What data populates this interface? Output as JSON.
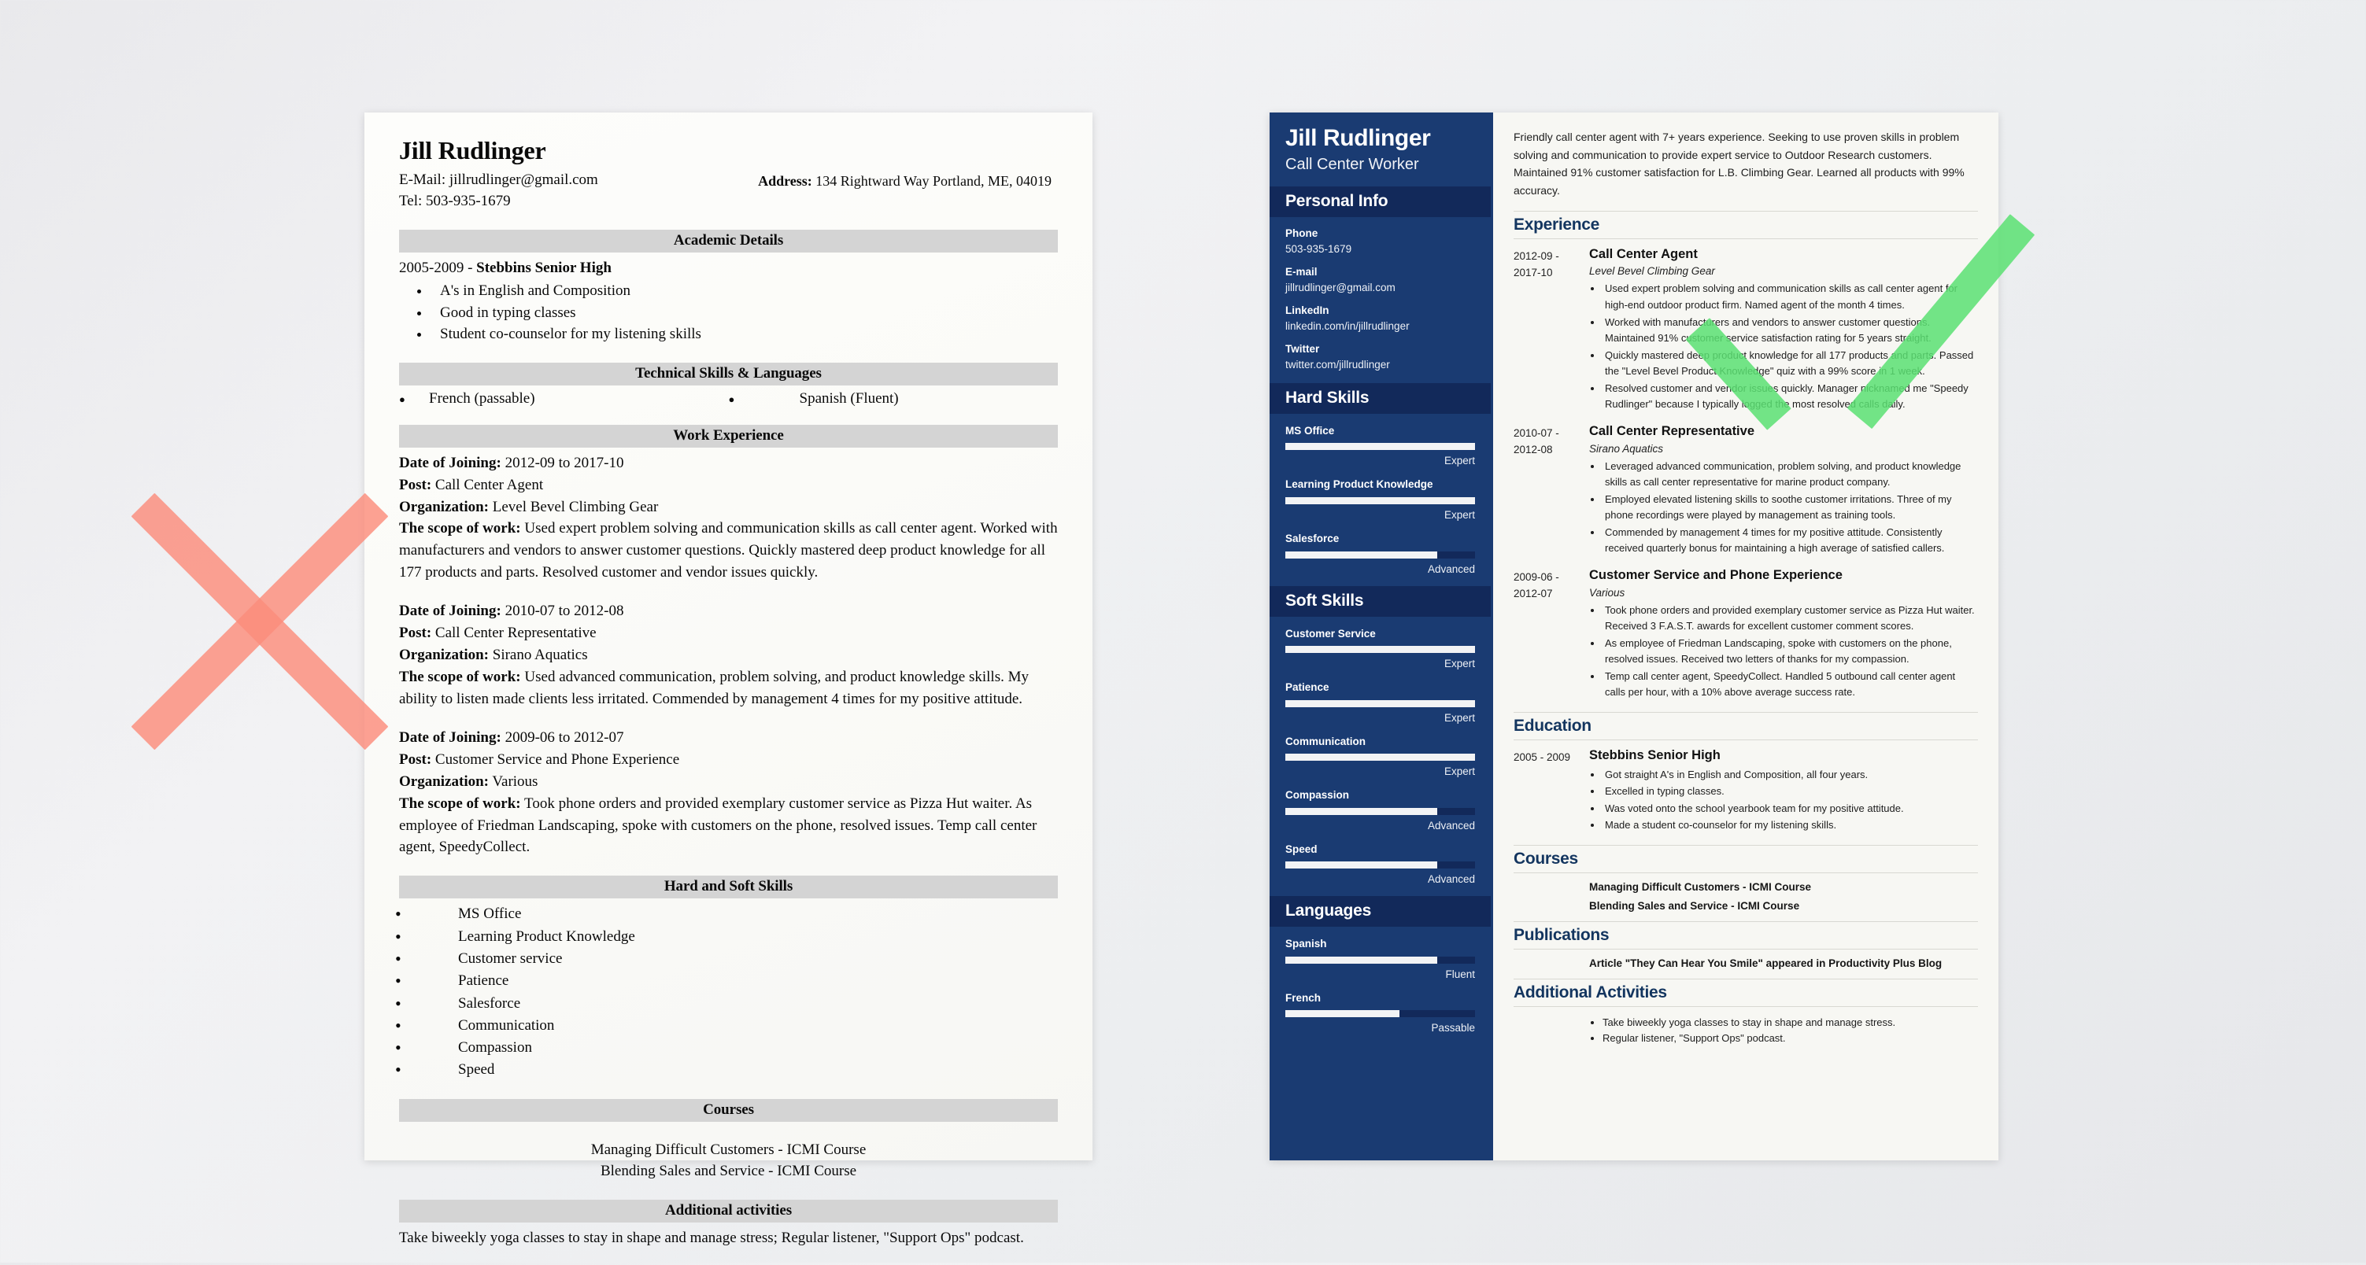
{
  "candidate": {
    "name": "Jill Rudlinger",
    "role": "Call Center Worker",
    "email": "jillrudlinger@gmail.com",
    "phone": "503-935-1679",
    "address": "134 Rightward Way Portland, ME, 04019",
    "linkedin": "linkedin.com/in/jillrudlinger",
    "twitter": "twitter.com/jillrudlinger"
  },
  "colors": {
    "sidebar_blue": "#1a3b72",
    "sidebar_header_blue": "#12295a",
    "accent_heading": "#13355f",
    "band_gray": "#d4d4d4",
    "mark_bad_red": "#FB8C7B",
    "mark_good_green": "#5BE072"
  },
  "marks": {
    "bad_mark": "x-mark",
    "good_mark": "check-mark"
  },
  "bad_resume": {
    "name": "Jill Rudlinger",
    "email_line": "E-Mail: jillrudlinger@gmail.com",
    "tel_line": "Tel: 503-935-1679",
    "address_label": "Address:",
    "address_value": "134 Rightward Way Portland, ME, 04019",
    "sections": {
      "academic": {
        "heading": "Academic Details",
        "school_line_years": "2005-2009 - ",
        "school_line_name": "Stebbins Senior High",
        "bullets": [
          "A's in English and Composition",
          "Good in typing classes",
          "Student co-counselor for my listening skills"
        ]
      },
      "technical": {
        "heading": "Technical Skills & Languages",
        "left": "French (passable)",
        "right": "Spanish (Fluent)"
      },
      "work": {
        "heading": "Work Experience",
        "jobs": [
          {
            "date_label": "Date of Joining:",
            "date_value": " 2012-09 to 2017-10",
            "post_label": "Post:",
            "post_value": " Call Center Agent",
            "org_label": "Organization:",
            "org_value": " Level Bevel Climbing Gear",
            "scope_label": "The scope of work:",
            "scope_value": " Used expert problem solving and communication skills as call center agent. Worked with manufacturers and vendors to answer customer questions. Quickly mastered deep product knowledge for all 177 products and parts. Resolved customer and vendor issues quickly."
          },
          {
            "date_label": "Date of Joining:",
            "date_value": " 2010-07 to 2012-08",
            "post_label": "Post:",
            "post_value": " Call Center Representative",
            "org_label": "Organization:",
            "org_value": " Sirano Aquatics",
            "scope_label": "The scope of work:",
            "scope_value": " Used advanced communication, problem solving, and product knowledge skills. My ability to listen made clients less irritated. Commended by management 4 times for my positive attitude."
          },
          {
            "date_label": "Date of Joining:",
            "date_value": " 2009-06 to 2012-07",
            "post_label": "Post:",
            "post_value": " Customer Service and Phone Experience",
            "org_label": "Organization:",
            "org_value": " Various",
            "scope_label": "The scope of work:",
            "scope_value": " Took phone orders and provided exemplary customer service as Pizza Hut waiter. As employee of Friedman Landscaping, spoke with customers on the phone, resolved issues. Temp call center agent, SpeedyCollect."
          }
        ]
      },
      "skills": {
        "heading": "Hard and Soft Skills",
        "items": [
          "MS Office",
          "Learning Product Knowledge",
          "Customer service",
          "Patience",
          "Salesforce",
          "Communication",
          "Compassion",
          "Speed"
        ]
      },
      "courses": {
        "heading": "Courses",
        "items": [
          "Managing Difficult Customers - ICMI Course",
          "Blending Sales and Service - ICMI Course"
        ]
      },
      "additional": {
        "heading": "Additional activities",
        "text": "Take biweekly yoga classes to stay in shape and manage stress; Regular listener, \"Support Ops\" podcast."
      }
    }
  },
  "good_resume": {
    "sidebar": {
      "name": "Jill Rudlinger",
      "role": "Call Center Worker",
      "personal_info_heading": "Personal Info",
      "personal_info": [
        {
          "label": "Phone",
          "value": "503-935-1679"
        },
        {
          "label": "E-mail",
          "value": "jillrudlinger@gmail.com"
        },
        {
          "label": "LinkedIn",
          "value": "linkedin.com/in/jillrudlinger"
        },
        {
          "label": "Twitter",
          "value": "twitter.com/jillrudlinger"
        }
      ],
      "hard_skills_heading": "Hard Skills",
      "hard_skills": [
        {
          "name": "MS Office",
          "level": "Expert",
          "pct": 100
        },
        {
          "name": "Learning Product Knowledge",
          "level": "Expert",
          "pct": 100
        },
        {
          "name": "Salesforce",
          "level": "Advanced",
          "pct": 80
        }
      ],
      "soft_skills_heading": "Soft Skills",
      "soft_skills": [
        {
          "name": "Customer Service",
          "level": "Expert",
          "pct": 100
        },
        {
          "name": "Patience",
          "level": "Expert",
          "pct": 100
        },
        {
          "name": "Communication",
          "level": "Expert",
          "pct": 100
        },
        {
          "name": "Compassion",
          "level": "Advanced",
          "pct": 80
        },
        {
          "name": "Speed",
          "level": "Advanced",
          "pct": 80
        }
      ],
      "languages_heading": "Languages",
      "languages": [
        {
          "name": "Spanish",
          "level": "Fluent",
          "pct": 80
        },
        {
          "name": "French",
          "level": "Passable",
          "pct": 60
        }
      ]
    },
    "summary": "Friendly call center agent with 7+ years experience. Seeking to use proven skills in problem solving and communication to provide expert service to Outdoor Research customers. Maintained 91% customer satisfaction for L.B. Climbing Gear. Learned all products with 99% accuracy.",
    "experience_heading": "Experience",
    "experience": [
      {
        "date": "2012-09 - 2017-10",
        "title": "Call Center Agent",
        "org": "Level Bevel Climbing Gear",
        "bullets": [
          "Used expert problem solving and communication skills as call center agent for high-end outdoor product firm. Named agent of the month 4 times.",
          "Worked with manufacturers and vendors to answer customer questions. Maintained 91% customer service satisfaction rating for 5 years straight.",
          "Quickly mastered deep product knowledge for all 177 products and parts. Passed the \"Level Bevel Product Knowledge\" quiz with a 99% score in 1 week.",
          "Resolved customer and vendor issues quickly. Manager nicknamed me \"Speedy Rudlinger\" because I typically logged the most resolved calls daily."
        ]
      },
      {
        "date": "2010-07 - 2012-08",
        "title": "Call Center Representative",
        "org": "Sirano Aquatics",
        "bullets": [
          "Leveraged advanced communication, problem solving, and product knowledge skills as call center representative for marine product company.",
          "Employed elevated listening skills to soothe customer irritations. Three of my phone recordings were played by management as training tools.",
          "Commended by management 4 times for my positive attitude. Consistently received quarterly bonus for maintaining a high average of satisfied callers."
        ]
      },
      {
        "date": "2009-06 - 2012-07",
        "title": "Customer Service and Phone Experience",
        "org": "Various",
        "bullets": [
          "Took phone orders and provided exemplary customer service as Pizza Hut waiter. Received 3 F.A.S.T. awards for excellent customer comment scores.",
          "As employee of Friedman Landscaping, spoke with customers on the phone, resolved issues. Received two letters of thanks for my compassion.",
          "Temp call center agent, SpeedyCollect. Handled 5 outbound call center agent calls per hour, with a 10% above average success rate."
        ]
      }
    ],
    "education_heading": "Education",
    "education": [
      {
        "date": "2005 - 2009",
        "title": "Stebbins Senior High",
        "bullets": [
          "Got straight A's in English and Composition, all four years.",
          "Excelled in typing classes.",
          "Was voted onto the school yearbook team for my positive attitude.",
          "Made a student co-counselor for my listening skills."
        ]
      }
    ],
    "courses_heading": "Courses",
    "courses": [
      "Managing Difficult Customers - ICMI Course",
      "Blending Sales and Service - ICMI Course"
    ],
    "publications_heading": "Publications",
    "publications": [
      "Article \"They Can Hear You Smile\" appeared in Productivity Plus Blog"
    ],
    "additional_heading": "Additional Activities",
    "additional": [
      "Take biweekly yoga classes to stay in shape and manage stress.",
      "Regular listener, \"Support Ops\" podcast."
    ]
  }
}
